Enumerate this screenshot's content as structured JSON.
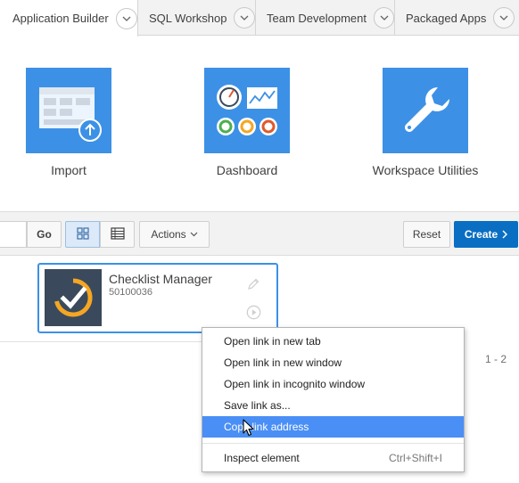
{
  "tabs": [
    {
      "label": "Application Builder",
      "active": true
    },
    {
      "label": "SQL Workshop",
      "active": false
    },
    {
      "label": "Team Development",
      "active": false
    },
    {
      "label": "Packaged Apps",
      "active": false
    }
  ],
  "hero": {
    "import_label": "Import",
    "dashboard_label": "Dashboard",
    "utilities_label": "Workspace Utilities"
  },
  "toolbar": {
    "go_label": "Go",
    "actions_label": "Actions",
    "reset_label": "Reset",
    "create_label": "Create"
  },
  "card": {
    "title": "Checklist Manager",
    "app_id": "50100036"
  },
  "pagination": "1 - 2",
  "context_menu": {
    "items": [
      {
        "label": "Open link in new tab"
      },
      {
        "label": "Open link in new window"
      },
      {
        "label": "Open link in incognito window"
      },
      {
        "label": "Save link as..."
      },
      {
        "label": "Copy link address",
        "highlighted": true
      }
    ],
    "inspect_label": "Inspect element",
    "inspect_shortcut": "Ctrl+Shift+I"
  },
  "colors": {
    "tile_blue": "#3c91e6",
    "primary_button": "#0a6fc2",
    "menu_highlight": "#4a8ff5",
    "logo_dark": "#3a4a5c",
    "logo_accent": "#f5a623"
  }
}
